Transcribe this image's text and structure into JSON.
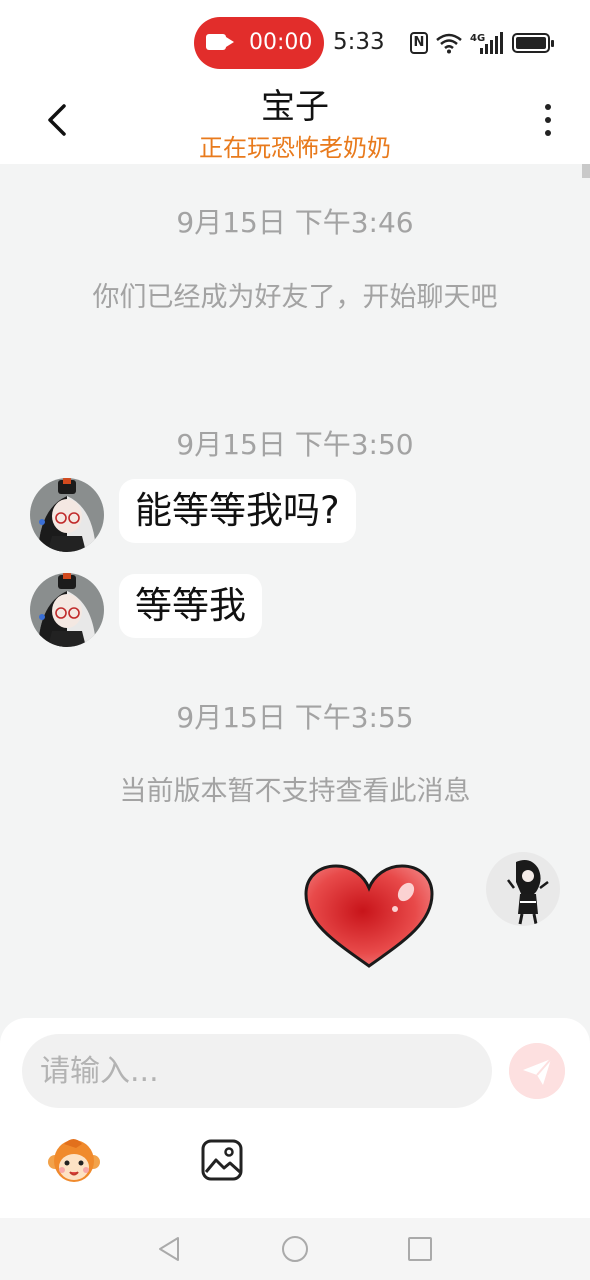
{
  "status_bar": {
    "recording_time": "00:00",
    "clock": "5:33",
    "icons": [
      "video-record-icon",
      "nfc-icon",
      "wifi-icon",
      "signal-4g-icon",
      "battery-icon"
    ]
  },
  "header": {
    "title": "宝子",
    "subtitle": "正在玩恐怖老奶奶",
    "back_icon": "chevron-left-icon",
    "more_icon": "more-vertical-icon"
  },
  "messages": {
    "ts1": "9月15日 下午3:46",
    "system1": "你们已经成为好友了，开始聊天吧",
    "ts2": "9月15日 下午3:50",
    "msg1": "能等等我吗?",
    "msg2": "等等我",
    "ts3": "9月15日 下午3:55",
    "system2": "当前版本暂不支持查看此消息",
    "sticker_icon": "red-heart-icon"
  },
  "input": {
    "placeholder": "请输入...",
    "send_icon": "paper-plane-icon",
    "emoji_icon": "monkey-emoji-icon",
    "image_icon": "image-picker-icon"
  },
  "colors": {
    "accent_orange": "#e87a1c",
    "record_red": "#e22d2b",
    "chat_bg": "#f3f4f4",
    "send_pink": "#fde0e0"
  }
}
